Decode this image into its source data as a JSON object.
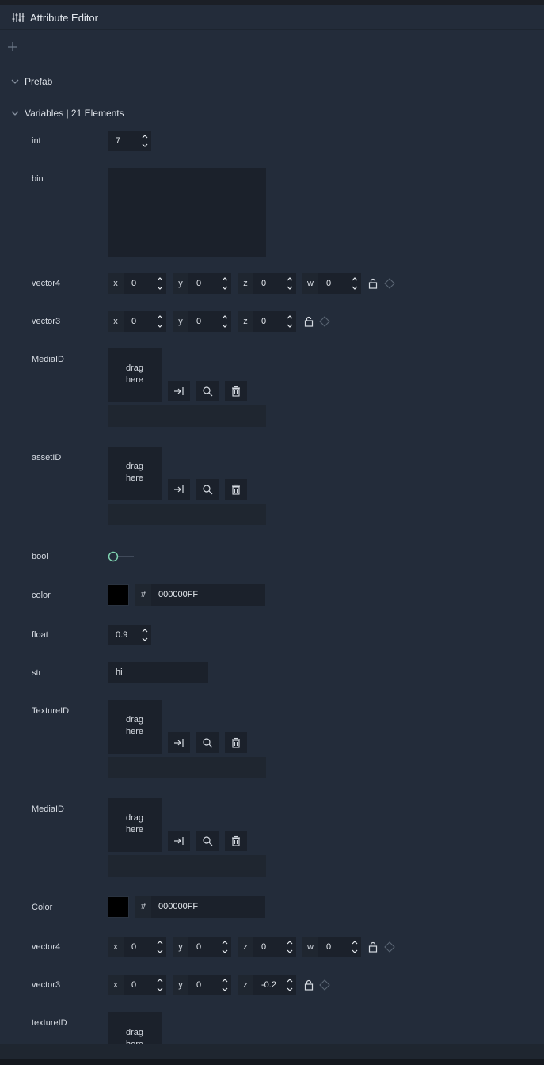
{
  "header": {
    "title": "Attribute Editor"
  },
  "sections": {
    "prefab": "Prefab",
    "variables": "Variables | 21 Elements"
  },
  "labels": {
    "int": "int",
    "bin": "bin",
    "vector4": "vector4",
    "vector3": "vector3",
    "mediaID": "MediaID",
    "assetID": "assetID",
    "bool": "bool",
    "color": "color",
    "float": "float",
    "str": "str",
    "textureID": "TextureID",
    "mediaID2": "MediaID",
    "color2": "Color",
    "vector4b": "vector4",
    "vector3b": "vector3",
    "textureID2": "textureID"
  },
  "axes": {
    "x": "x",
    "y": "y",
    "z": "z",
    "w": "w"
  },
  "values": {
    "int": "7",
    "vector4": {
      "x": "0",
      "y": "0",
      "z": "0",
      "w": "0"
    },
    "vector3": {
      "x": "0",
      "y": "0",
      "z": "0"
    },
    "bool": false,
    "color_hex": "000000FF",
    "float": "0.9",
    "str": "hi",
    "color2_hex": "000000FF",
    "vector4b": {
      "x": "0",
      "y": "0",
      "z": "0",
      "w": "0"
    },
    "vector3b": {
      "x": "0",
      "y": "0",
      "z": "-0.2"
    }
  },
  "drag": {
    "line1": "drag",
    "line2": "here"
  },
  "color_prefix": "#",
  "colors": {
    "panel": "#232c3a",
    "field": "#1b212b",
    "toggle_accent": "#7fd3b0",
    "swatch": "#000000"
  },
  "icons": [
    "sliders-icon",
    "plus-icon",
    "chevron-down-icon",
    "spin-up-icon",
    "spin-down-icon",
    "lock-icon",
    "link-diamond-icon",
    "assign-arrow-icon",
    "search-icon",
    "trash-icon"
  ]
}
